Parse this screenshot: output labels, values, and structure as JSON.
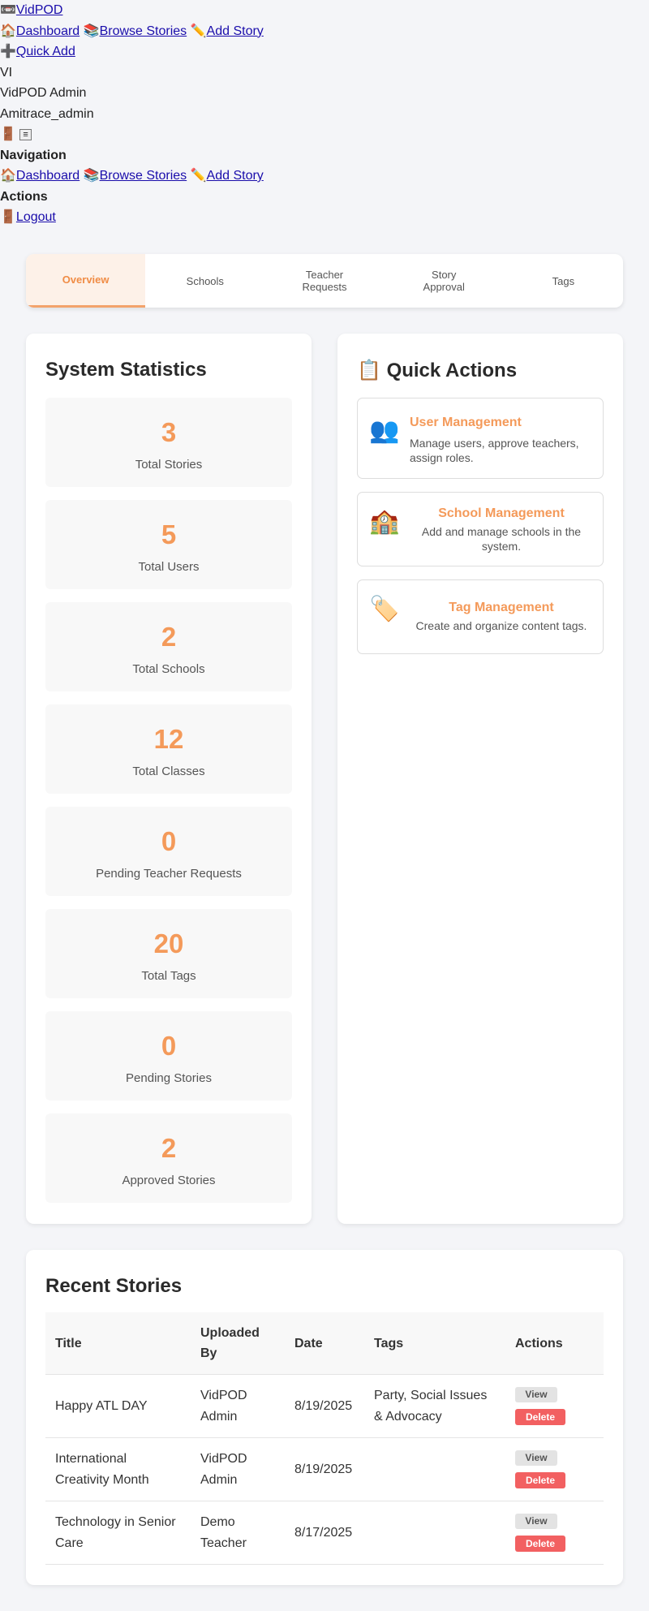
{
  "topnav": {
    "brand_icon": "📼",
    "brand": "VidPOD",
    "dashboard_icon": "🏠",
    "dashboard": "Dashboard",
    "browse_icon": "📚",
    "browse": "Browse Stories",
    "add_icon": "✏️",
    "add": "Add Story",
    "quick_add_icon": "➕",
    "quick_add": "Quick Add",
    "avatar_initials": "VI",
    "user_name": "VidPOD Admin",
    "user_handle": "Amitrace_admin",
    "door_icon": "🚪",
    "menu_glyph": "≡",
    "nav_heading": "Navigation",
    "actions_heading": "Actions",
    "logout_icon": "🚪",
    "logout": "Logout"
  },
  "tabs": [
    {
      "label": "Overview",
      "active": true
    },
    {
      "label": "Schools",
      "active": false
    },
    {
      "label": "Teacher\nRequests",
      "active": false
    },
    {
      "label": "Story\nApproval",
      "active": false
    },
    {
      "label": "Tags",
      "active": false
    }
  ],
  "stats": {
    "title": "System Statistics",
    "items": [
      {
        "value": "3",
        "label": "Total Stories"
      },
      {
        "value": "5",
        "label": "Total Users"
      },
      {
        "value": "2",
        "label": "Total Schools"
      },
      {
        "value": "12",
        "label": "Total Classes"
      },
      {
        "value": "0",
        "label": "Pending Teacher Requests"
      },
      {
        "value": "20",
        "label": "Total Tags"
      },
      {
        "value": "0",
        "label": "Pending Stories"
      },
      {
        "value": "2",
        "label": "Approved Stories"
      }
    ]
  },
  "quick_actions": {
    "title_icon": "📋",
    "title": "Quick Actions",
    "items": [
      {
        "icon": "👥",
        "title": "User Management",
        "desc": "Manage users, approve teachers, assign roles."
      },
      {
        "icon": "🏫",
        "title": "School Management",
        "desc": "Add and manage schools in the system."
      },
      {
        "icon": "🏷️",
        "title": "Tag Management",
        "desc": "Create and organize content tags."
      }
    ]
  },
  "recent": {
    "title": "Recent Stories",
    "columns": [
      "Title",
      "Uploaded By",
      "Date",
      "Tags",
      "Actions"
    ],
    "rows": [
      {
        "title": "Happy ATL DAY",
        "by": "VidPOD Admin",
        "date": "8/19/2025",
        "tags": "Party, Social Issues & Advocacy"
      },
      {
        "title": "International Creativity Month",
        "by": "VidPOD Admin",
        "date": "8/19/2025",
        "tags": ""
      },
      {
        "title": "Technology in Senior Care",
        "by": "Demo Teacher",
        "date": "8/17/2025",
        "tags": ""
      }
    ],
    "view_label": "View",
    "delete_label": "Delete"
  },
  "colors": {
    "accent": "#f49a5a",
    "danger": "#f26061",
    "background": "#f4f5f8"
  }
}
